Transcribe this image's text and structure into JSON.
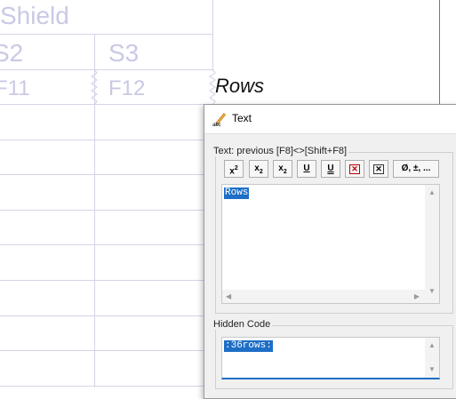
{
  "canvas": {
    "shield_text": "Shield",
    "row2_cells": [
      "S2",
      "S3"
    ],
    "row3_cells": [
      "F11",
      "F12"
    ],
    "rows_label": "Rows"
  },
  "dialog": {
    "title": "Text",
    "title_icon": "pencil-text-icon",
    "text_group_label": "Text: previous [F8]<>[Shift+F8]",
    "toolbar": {
      "superscript": "x",
      "subscript": "x",
      "super_sub": "x",
      "underline": "U",
      "double_underline": "U",
      "symbols": "Ø, ±, ..."
    },
    "text_value": "Rows",
    "hidden_code_label": "Hidden Code",
    "hidden_code_value": ":36rows:"
  },
  "colors": {
    "grid": "#d4d4ea",
    "ghost_text": "#c9c9e6",
    "selection": "#1e6ec6",
    "accent_underline": "#1f6fc6",
    "green_line": "#3aa63a"
  }
}
